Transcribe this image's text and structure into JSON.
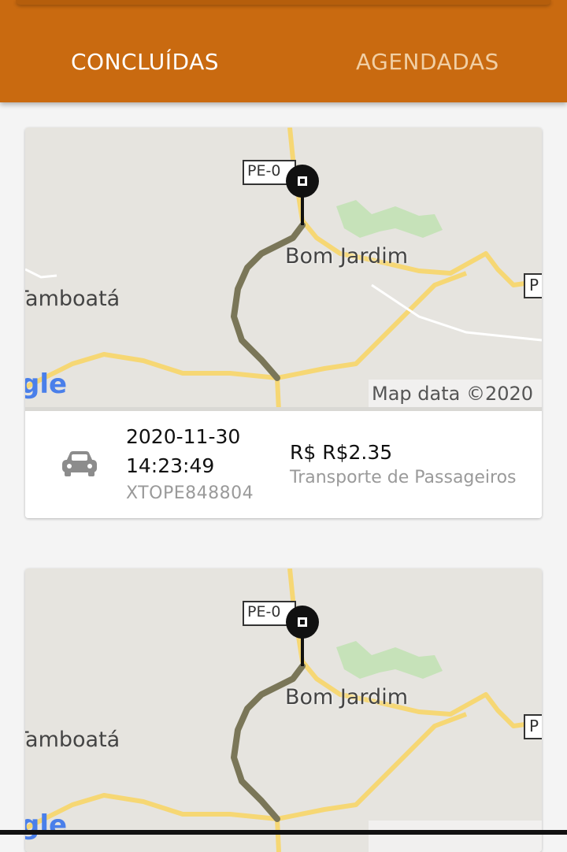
{
  "tabs": {
    "completed": "CONCLUÍDAS",
    "scheduled": "AGENDADAS"
  },
  "colors": {
    "appbar": "#c96a10",
    "active_tab": "#ffffff",
    "inactive_tab": "#f1cfa4"
  },
  "map": {
    "road_label": "PE-0",
    "town_label": "Bom Jardim",
    "area_label": "Tamboatá",
    "right_label": "P",
    "logo_text": "gle",
    "attribution": "Map data ©2020"
  },
  "rides": [
    {
      "date": "2020-11-30",
      "time": "14:23:49",
      "ride_id": "XTOPE848804",
      "price": "R$ R$2.35",
      "category": "Transporte de Passageiros",
      "icon": "car-icon"
    }
  ]
}
